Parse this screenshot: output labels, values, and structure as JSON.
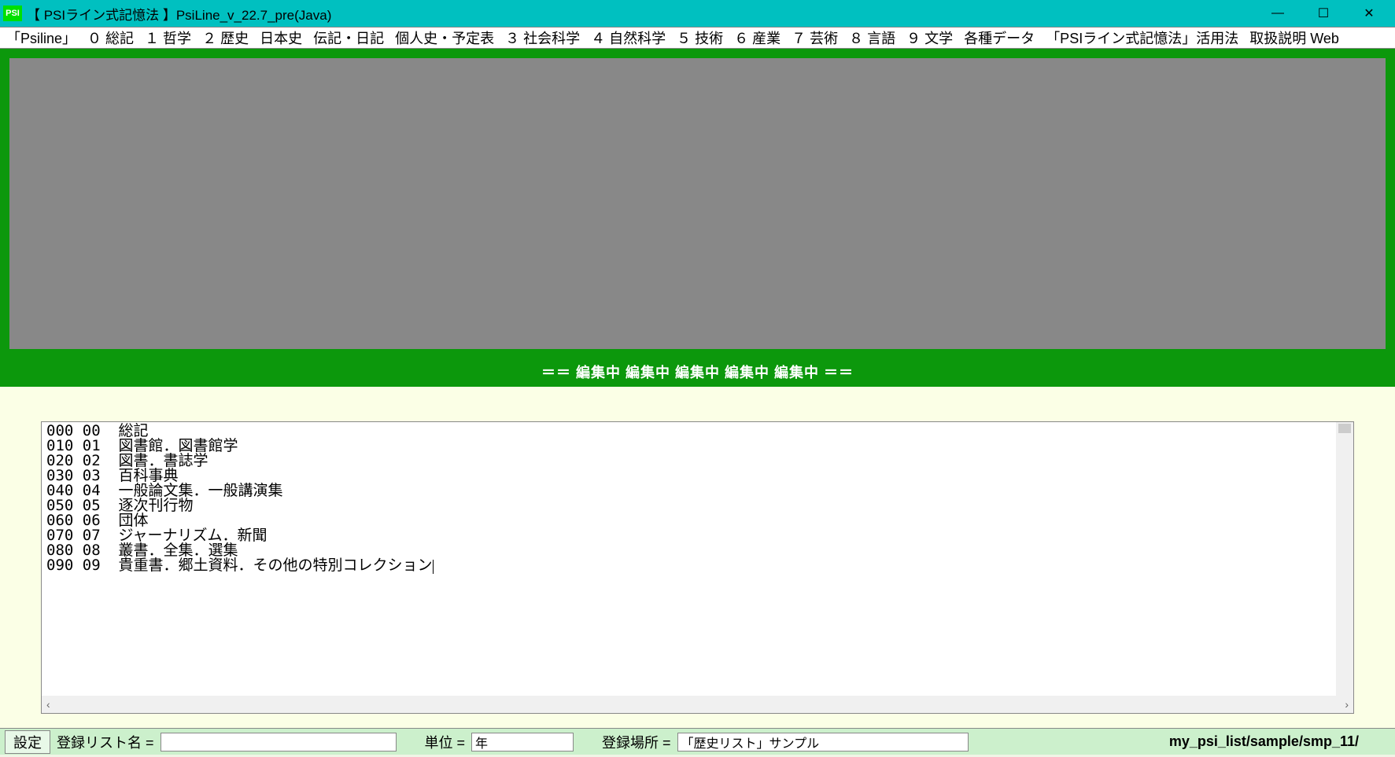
{
  "title": {
    "icon": "PSI",
    "text": "【 PSIライン式記憶法 】PsiLine_v_22.7_pre(Java)"
  },
  "win": {
    "min": "—",
    "max": "☐",
    "close": "✕"
  },
  "menu": [
    "「Psiline」",
    "０ 総記",
    "１ 哲学",
    "２ 歴史",
    "日本史",
    "伝記・日記",
    "個人史・予定表",
    "３ 社会科学",
    "４ 自然科学",
    "５ 技術",
    "６ 産業",
    "７ 芸術",
    "８ 言語",
    "９ 文学",
    "各種データ",
    "「PSIライン式記憶法」活用法",
    "取扱説明 Web"
  ],
  "editing_label": "＝＝ 編集中 編集中 編集中 編集中 編集中 ＝＝",
  "text_lines": [
    "000 00  総記",
    "010 01  図書館．図書館学",
    "020 02  図書．書誌学",
    "030 03  百科事典",
    "040 04  一般論文集．一般講演集",
    "050 05  逐次刊行物",
    "060 06  団体",
    "070 07  ジャーナリズム．新聞",
    "080 08  叢書．全集．選集",
    "090 09  貴重書．郷土資料．その他の特別コレクション"
  ],
  "scroll": {
    "left": "‹",
    "right": "›"
  },
  "status": {
    "settings": "設定",
    "listname_label": "登録リスト名 =",
    "listname_value": "",
    "unit_label": "単位 =",
    "unit_value": "年",
    "place_label": "登録場所 =",
    "place_value": "「歴史リスト」サンプル",
    "path": "my_psi_list/sample/smp_11/"
  }
}
